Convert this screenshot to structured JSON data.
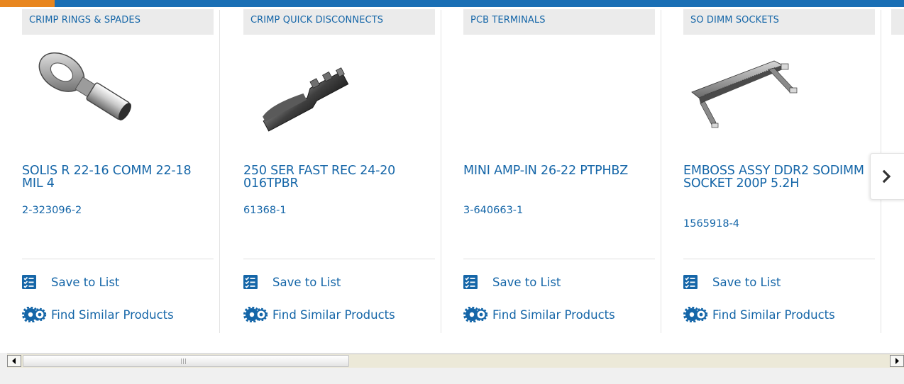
{
  "colors": {
    "link": "#1566a8",
    "accent_orange": "#e8861f",
    "top_bar_blue": "#1a6fb5",
    "category_bg": "#ebebeb"
  },
  "products": [
    {
      "category": "CRIMP RINGS & SPADES",
      "title": "SOLIS R 22-16 COMM 22-18 MIL 4",
      "part_number": "2-323096-2",
      "image": "ring-terminal",
      "save_label": "Save to List",
      "find_label": "Find Similar Products"
    },
    {
      "category": "CRIMP QUICK DISCONNECTS",
      "title": "250 SER FAST REC 24-20 016TPBR",
      "part_number": "61368-1",
      "image": "quick-disconnect",
      "save_label": "Save to List",
      "find_label": "Find Similar Products"
    },
    {
      "category": "PCB TERMINALS",
      "title": "MINI AMP-IN 26-22 PTPHBZ",
      "part_number": "3-640663-1",
      "image": "",
      "save_label": "Save to List",
      "find_label": "Find Similar Products"
    },
    {
      "category": "SO DIMM SOCKETS",
      "title": "EMBOSS ASSY DDR2 SODIMM SOCKET 200P 5.2H",
      "part_number": "1565918-4",
      "image": "sodimm-socket",
      "save_label": "Save to List",
      "find_label": "Find Similar Products"
    }
  ],
  "carousel": {
    "next_icon": "chevron-right-icon"
  },
  "scrollbar": {
    "left_icon": "arrow-left-icon",
    "right_icon": "arrow-right-icon",
    "position": 0.0
  }
}
